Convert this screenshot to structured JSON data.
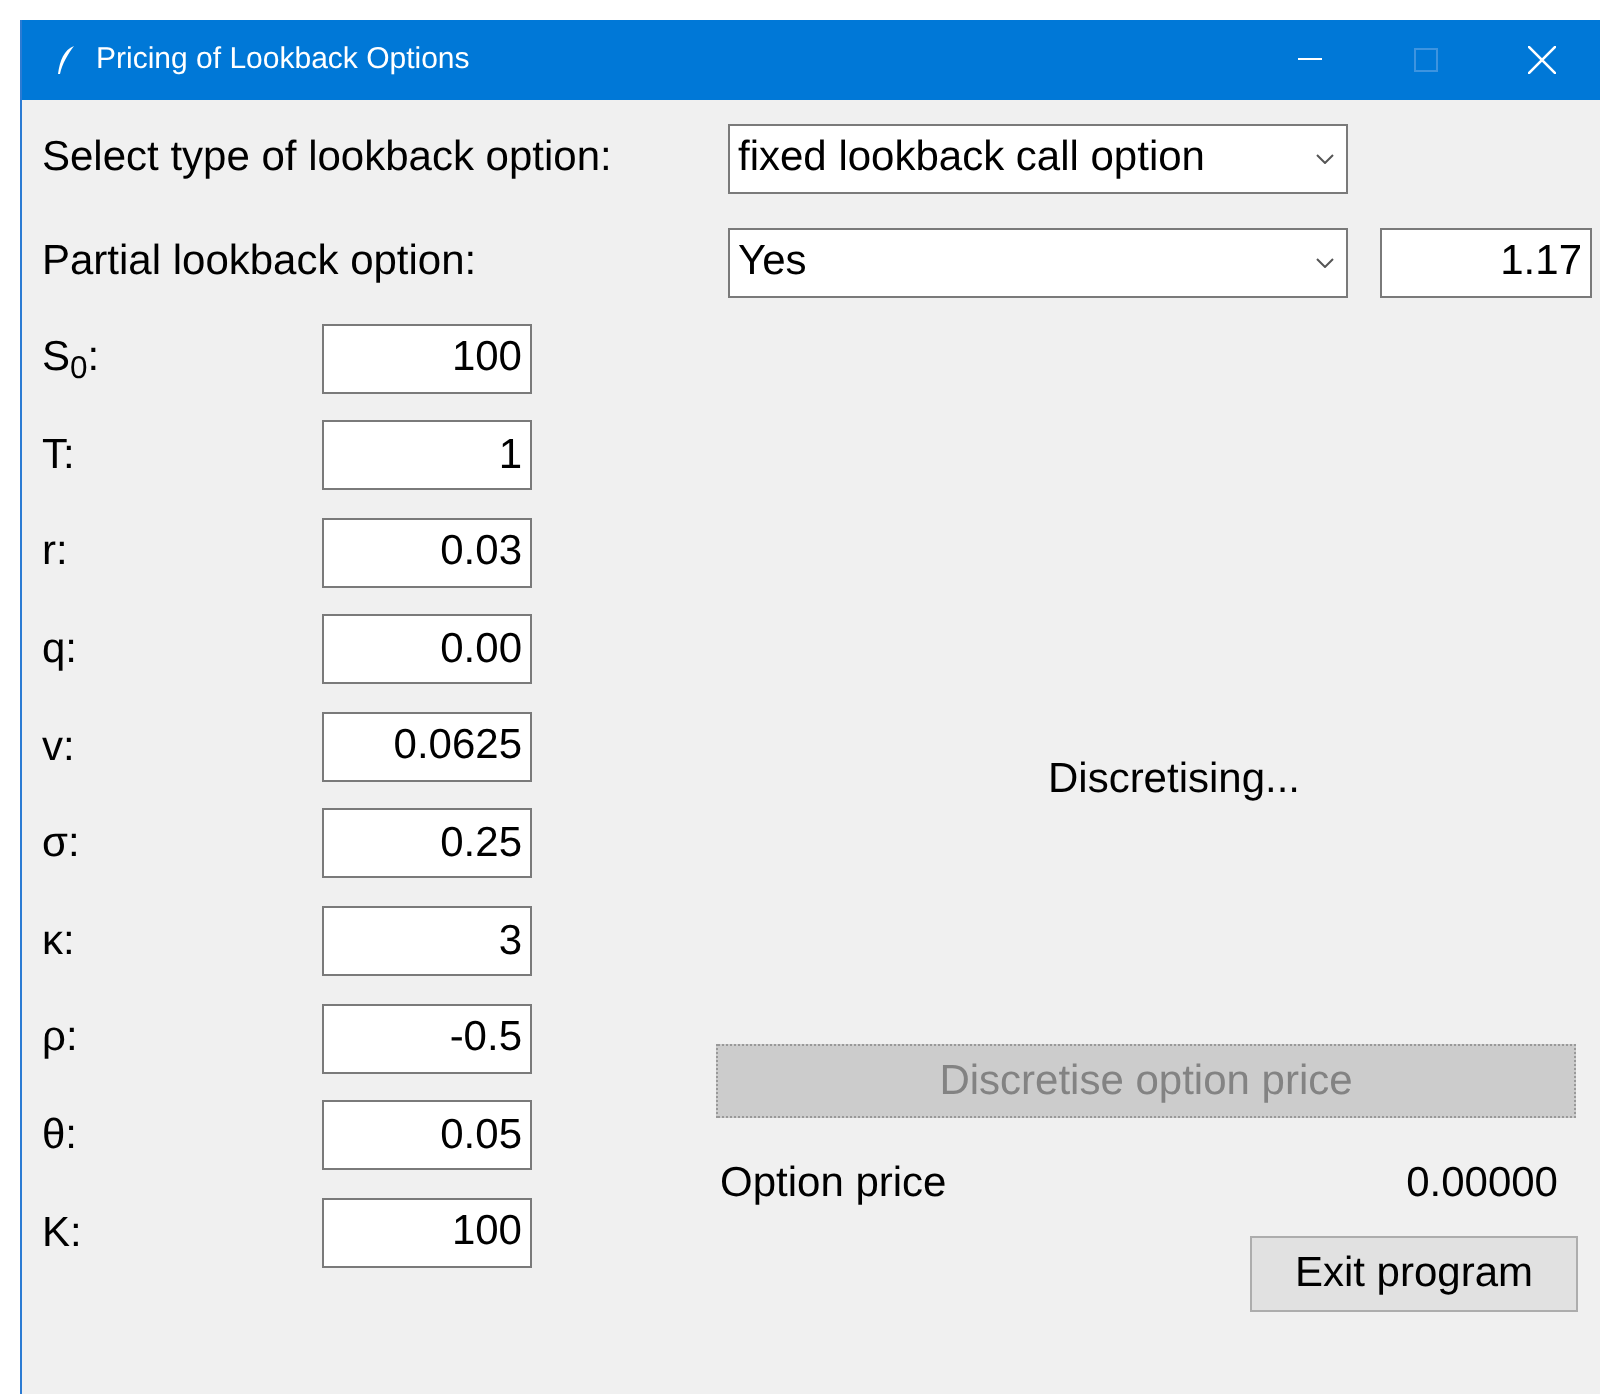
{
  "window": {
    "title": "Pricing of Lookback Options"
  },
  "option_type": {
    "label": "Select type of lookback option:",
    "value": "fixed lookback call option"
  },
  "partial": {
    "label": "Partial lookback option:",
    "value": "Yes",
    "parameter": "1.17"
  },
  "parameters": [
    {
      "label": "S$_{0}$:",
      "value": "100"
    },
    {
      "label": "T:",
      "value": "1"
    },
    {
      "label": "r:",
      "value": "0.03"
    },
    {
      "label": "q:",
      "value": "0.00"
    },
    {
      "label": "v:",
      "value": "0.0625"
    },
    {
      "label": "σ:",
      "value": "0.25"
    },
    {
      "label": "κ:",
      "value": "3"
    },
    {
      "label": "ρ:",
      "value": "-0.5"
    },
    {
      "label": "θ:",
      "value": "0.05"
    },
    {
      "label": "K:",
      "value": "100"
    }
  ],
  "status": "Discretising...",
  "discretise_button": {
    "label": "Discretise option price",
    "disabled": true
  },
  "result": {
    "label": "Option price",
    "value": "0.00000"
  },
  "exit_button": {
    "label": "Exit program"
  }
}
